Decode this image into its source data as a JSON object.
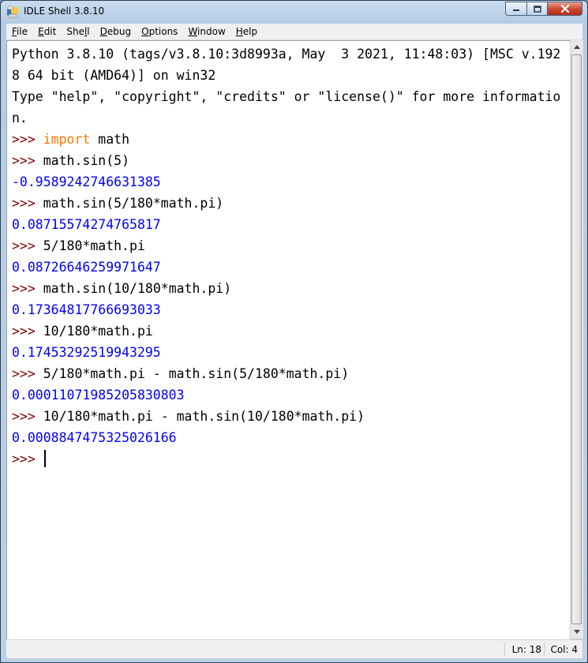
{
  "window": {
    "title": "IDLE Shell 3.8.10"
  },
  "menu": [
    {
      "pre": "",
      "key": "F",
      "post": "ile"
    },
    {
      "pre": "",
      "key": "E",
      "post": "dit"
    },
    {
      "pre": "She",
      "key": "l",
      "post": "l"
    },
    {
      "pre": "",
      "key": "D",
      "post": "ebug"
    },
    {
      "pre": "",
      "key": "O",
      "post": "ptions"
    },
    {
      "pre": "",
      "key": "W",
      "post": "indow"
    },
    {
      "pre": "",
      "key": "H",
      "post": "elp"
    }
  ],
  "shell_lines": [
    {
      "type": "banner",
      "text": "Python 3.8.10 (tags/v3.8.10:3d8993a, May  3 2021, 11:48:03) [MSC v.192"
    },
    {
      "type": "banner",
      "text": "8 64 bit (AMD64)] on win32"
    },
    {
      "type": "banner",
      "text": "Type \"help\", \"copyright\", \"credits\" or \"license()\" for more informatio"
    },
    {
      "type": "banner",
      "text": "n."
    },
    {
      "type": "input",
      "prompt": ">>> ",
      "keyword": "import",
      "code": " math"
    },
    {
      "type": "input",
      "prompt": ">>> ",
      "code": "math.sin(5)"
    },
    {
      "type": "output",
      "text": "-0.9589242746631385"
    },
    {
      "type": "input",
      "prompt": ">>> ",
      "code": "math.sin(5/180*math.pi)"
    },
    {
      "type": "output",
      "text": "0.08715574274765817"
    },
    {
      "type": "input",
      "prompt": ">>> ",
      "code": "5/180*math.pi"
    },
    {
      "type": "output",
      "text": "0.08726646259971647"
    },
    {
      "type": "input",
      "prompt": ">>> ",
      "code": "math.sin(10/180*math.pi)"
    },
    {
      "type": "output",
      "text": "0.17364817766693033"
    },
    {
      "type": "input",
      "prompt": ">>> ",
      "code": "10/180*math.pi"
    },
    {
      "type": "output",
      "text": "0.17453292519943295"
    },
    {
      "type": "input",
      "prompt": ">>> ",
      "code": "5/180*math.pi - math.sin(5/180*math.pi)"
    },
    {
      "type": "output",
      "text": "0.00011071985205830803"
    },
    {
      "type": "input",
      "prompt": ">>> ",
      "code": "10/180*math.pi - math.sin(10/180*math.pi)"
    },
    {
      "type": "output",
      "text": "0.0008847475325026166"
    },
    {
      "type": "current",
      "prompt": ">>> ",
      "code": ""
    }
  ],
  "status": {
    "line": "Ln: 18",
    "column": "Col: 4"
  },
  "colors": {
    "prompt": "#800000",
    "keyword": "#ff7700",
    "output": "#0000ff",
    "background": "#ffffff"
  }
}
